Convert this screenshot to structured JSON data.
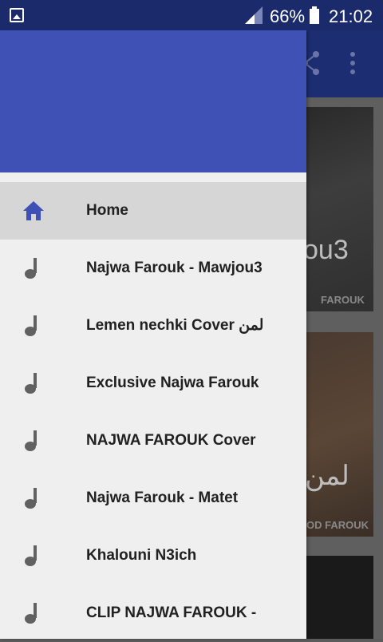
{
  "status_bar": {
    "battery_percent": "66%",
    "time": "21:02"
  },
  "background": {
    "card1_text": "ou3",
    "card1_caption": "FAROUK",
    "card2_text": "لمن",
    "card2_caption": "OD FAROUK"
  },
  "drawer": {
    "items": [
      {
        "label": "Home",
        "icon": "home-icon",
        "selected": true
      },
      {
        "label": "Najwa Farouk - Mawjou3",
        "icon": "music-note-icon"
      },
      {
        "label": "Lemen nechki Cover  لمن",
        "icon": "music-note-icon"
      },
      {
        "label": "Exclusive  Najwa Farouk",
        "icon": "music-note-icon"
      },
      {
        "label": "NAJWA FAROUK Cover",
        "icon": "music-note-icon"
      },
      {
        "label": "Najwa Farouk - Matet",
        "icon": "music-note-icon"
      },
      {
        "label": "Khalouni N3ich",
        "icon": "music-note-icon"
      },
      {
        "label": "CLIP NAJWA FAROUK -",
        "icon": "music-note-icon"
      }
    ]
  },
  "colors": {
    "primary": "#3f51b5",
    "status_bar": "#1b2a6b",
    "selected_row": "#d6d6d6",
    "drawer_bg": "#efefef",
    "icon_gray": "#616161"
  }
}
